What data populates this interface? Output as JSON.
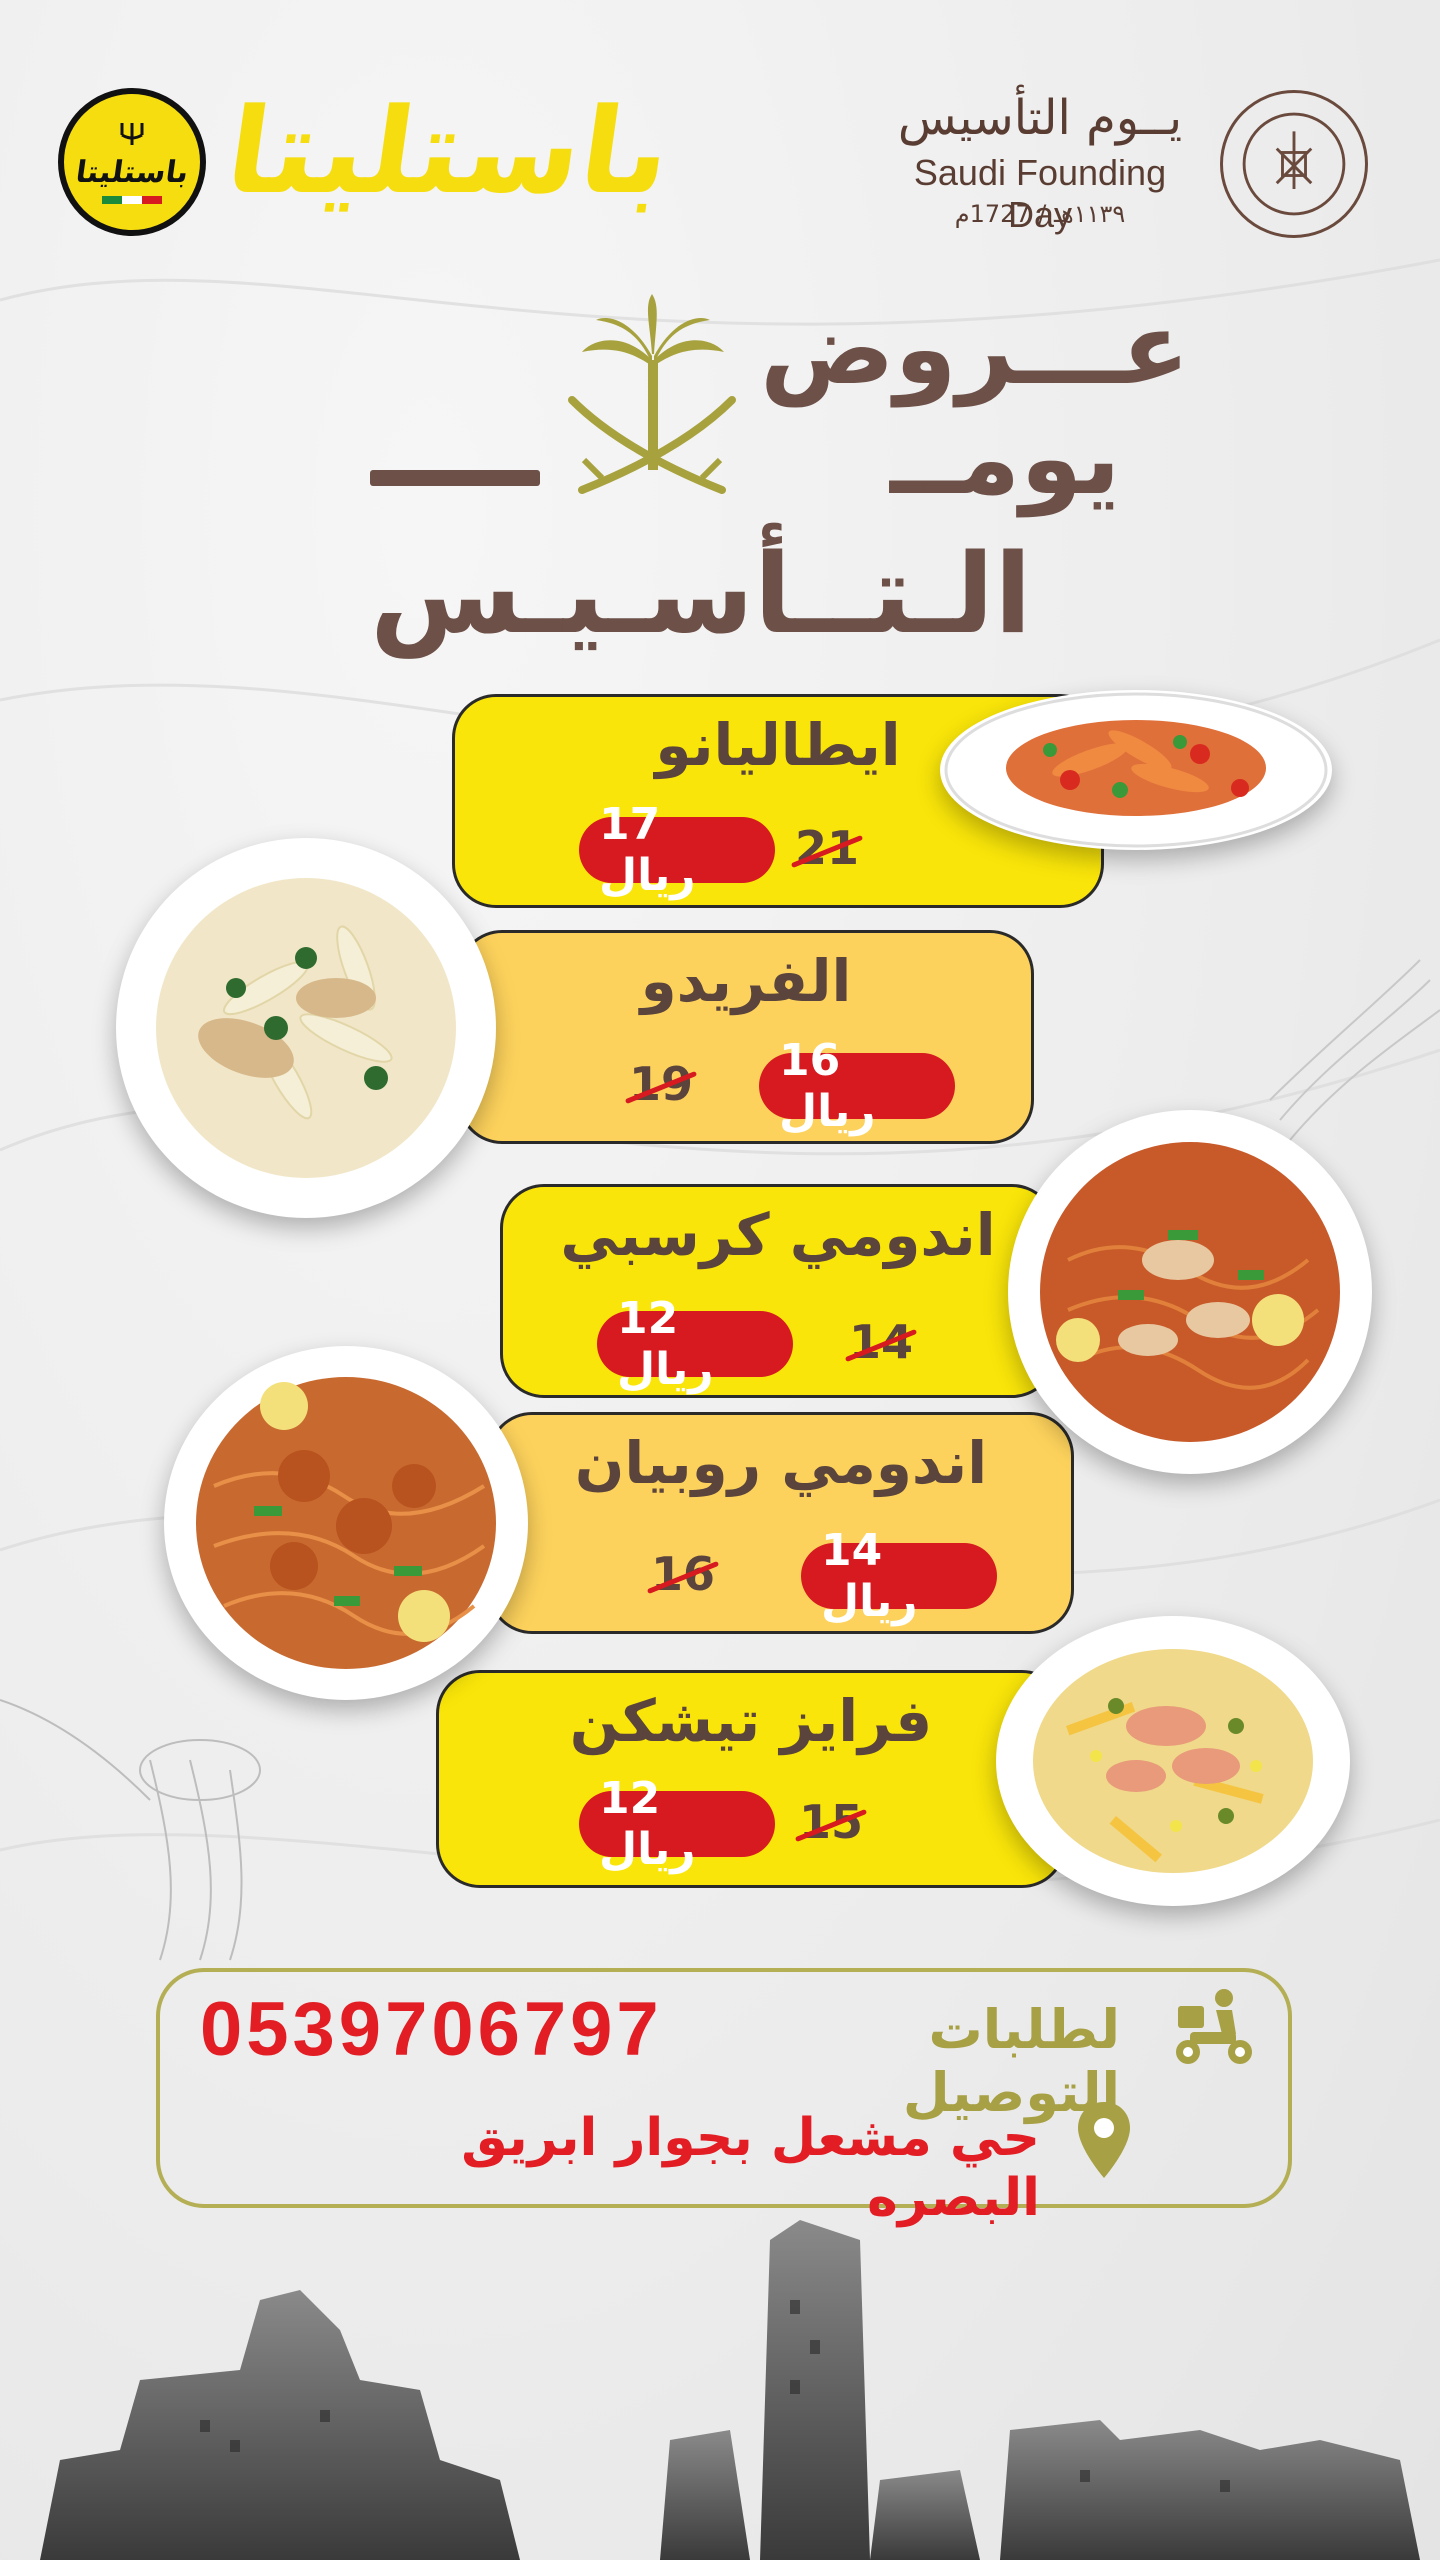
{
  "brand": {
    "name": "باستليتا",
    "badge_text": "باستليتا"
  },
  "founding_day": {
    "arabic": "يــوم التأسيس",
    "english": "Saudi Founding Day",
    "years": "١١٣٩هـ / 1727م"
  },
  "title": {
    "line1": "عـــروض",
    "line2": "يومــ",
    "line3": "الـتــأسـيـس"
  },
  "menu": [
    {
      "name": "ايطاليانو",
      "new_price": "17 ريال",
      "old_price": "21"
    },
    {
      "name": "الفريدو",
      "new_price": "16 ريال",
      "old_price": "19"
    },
    {
      "name": "اندومي كرسبي",
      "new_price": "12 ريال",
      "old_price": "14"
    },
    {
      "name": "اندومي روبيان",
      "new_price": "14 ريال",
      "old_price": "16"
    },
    {
      "name": "فرايز تيشكن",
      "new_price": "12 ريال",
      "old_price": "15"
    }
  ],
  "contact": {
    "phone": "0539706797",
    "delivery_label": "لطلبات التوصيل",
    "address": "حي مشعل بجوار ابريق البصره"
  },
  "colors": {
    "yellow": "#f9e509",
    "amber": "#fdd25c",
    "red": "#d71920",
    "brown": "#6d5048",
    "olive": "#b4ae54"
  },
  "icons": [
    "scooter-icon",
    "location-pin-icon",
    "palm-swords-emblem"
  ]
}
